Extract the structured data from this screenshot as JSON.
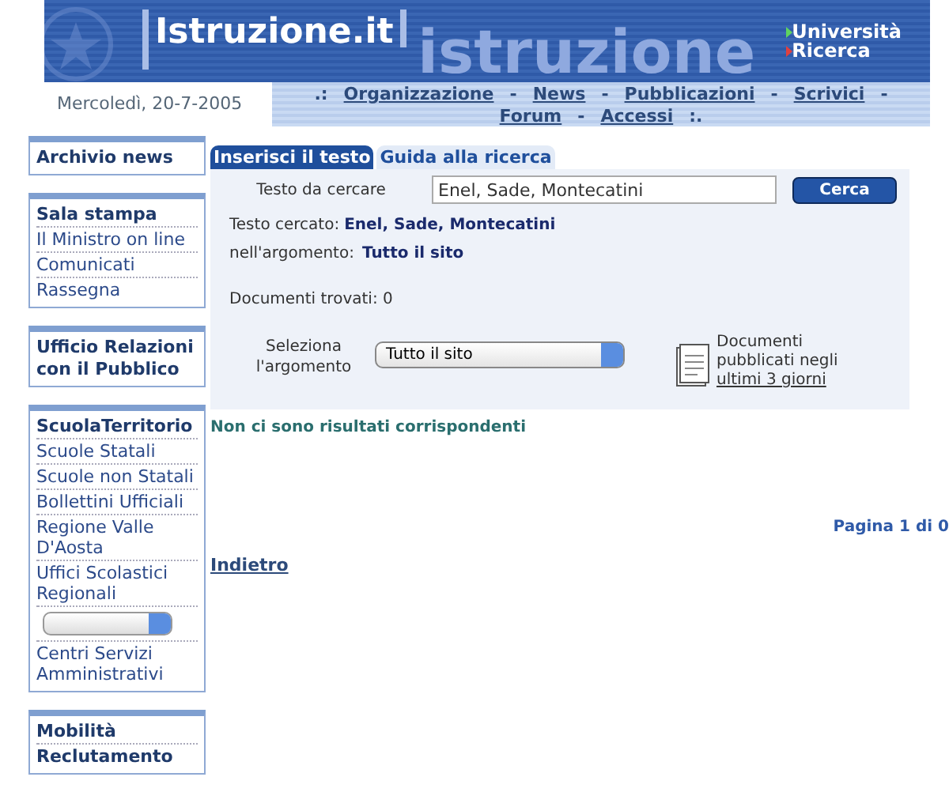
{
  "header": {
    "logo": "Istruzione.it",
    "logo_backdrop": "istruzione",
    "links": [
      {
        "label": "Università",
        "color": "#5fd35f"
      },
      {
        "label": "Ricerca",
        "color": "#e04040"
      }
    ]
  },
  "date": "Mercoledì, 20-7-2005",
  "nav": {
    "prefix": ".:",
    "suffix": ":.",
    "separator": "-",
    "items": [
      "Organizzazione",
      "News",
      "Pubblicazioni",
      "Scrivici",
      "Forum",
      "Accessi"
    ]
  },
  "sidebar": [
    {
      "title": "Archivio news"
    },
    {
      "title": "Sala stampa",
      "items": [
        {
          "kind": "link",
          "label": "Il Ministro on line"
        },
        {
          "kind": "link",
          "label": "Comunicati"
        },
        {
          "kind": "link",
          "label": "Rassegna"
        }
      ]
    },
    {
      "title": "Ufficio Relazioni con il Pubblico"
    },
    {
      "title": "ScuolaTerritorio",
      "items": [
        {
          "kind": "link",
          "label": "Scuole Statali"
        },
        {
          "kind": "link",
          "label": "Scuole non Statali"
        },
        {
          "kind": "link",
          "label": "Bollettini Ufficiali"
        },
        {
          "kind": "link",
          "label": "Regione Valle D'Aosta"
        },
        {
          "kind": "link",
          "label": "Uffici Scolastici Regionali"
        },
        {
          "kind": "select"
        },
        {
          "kind": "link",
          "label": "Centri Servizi Amministrativi"
        }
      ]
    },
    {
      "title": "Mobilità",
      "items": [
        {
          "kind": "title",
          "label": "Reclutamento"
        }
      ]
    }
  ],
  "tabs": [
    {
      "label": "Inserisci il testo",
      "selected": true
    },
    {
      "label": "Guida alla ricerca",
      "selected": false
    }
  ],
  "search": {
    "label": "Testo da cercare",
    "value": "Enel, Sade, Montecatini",
    "button": "Cerca"
  },
  "summary": {
    "searched_label": "Testo cercato:",
    "searched_value": "Enel, Sade, Montecatini",
    "topic_label": "nell'argomento:",
    "topic_value": "Tutto il sito",
    "found": "Documenti trovati: 0"
  },
  "topic_select": {
    "label": "Seleziona l'argomento",
    "value": "Tutto il sito"
  },
  "recent": {
    "text": "Documenti pubblicati negli",
    "link": "ultimi 3 giorni"
  },
  "no_results": "Non ci sono risultati corrispondenti",
  "pagination": "Pagina 1 di 0",
  "back": "Indietro"
}
